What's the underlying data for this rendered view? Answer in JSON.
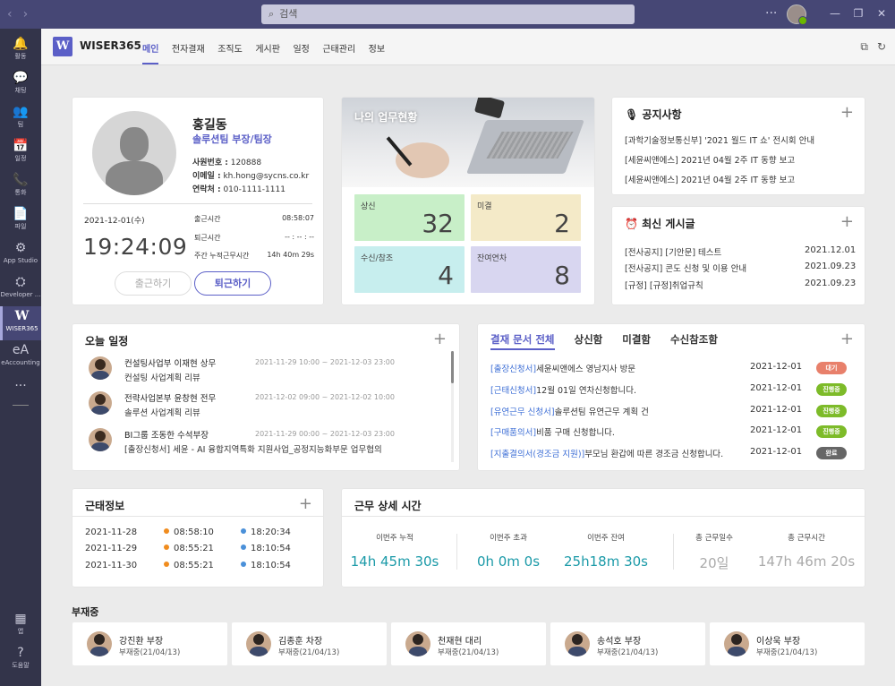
{
  "titlebar": {
    "search_placeholder": "검색"
  },
  "rail": [
    {
      "label": "활동",
      "icon": "bell-icon",
      "glyph": "🔔"
    },
    {
      "label": "채팅",
      "icon": "chat-icon",
      "glyph": "💬"
    },
    {
      "label": "팀",
      "icon": "team-icon",
      "glyph": "👥"
    },
    {
      "label": "일정",
      "icon": "calendar-icon",
      "glyph": "📅"
    },
    {
      "label": "통화",
      "icon": "phone-icon",
      "glyph": "📞"
    },
    {
      "label": "파일",
      "icon": "file-icon",
      "glyph": "📄"
    },
    {
      "label": "App Studio",
      "icon": "app-studio-icon",
      "glyph": "⚙"
    },
    {
      "label": "Developer ...",
      "icon": "developer-icon",
      "glyph": "⛭"
    },
    {
      "label": "WISER365",
      "icon": "wiser365-icon",
      "glyph": "W"
    },
    {
      "label": "eAccounting",
      "icon": "eaccounting-icon",
      "glyph": "eA"
    },
    {
      "label": "",
      "icon": "more-icon",
      "glyph": "···"
    }
  ],
  "rail_bottom": [
    {
      "label": "앱",
      "icon": "apps-icon",
      "glyph": "▦"
    },
    {
      "label": "도움말",
      "icon": "help-icon",
      "glyph": "?"
    }
  ],
  "appbar": {
    "logo_letter": "W",
    "app_name": "WISER365",
    "tabs": [
      "메인",
      "전자결재",
      "조직도",
      "게시판",
      "일정",
      "근태관리",
      "정보"
    ]
  },
  "profile": {
    "name": "홍길동",
    "title": "솔루션팀 부장/팀장",
    "emp_no_label": "사원번호 :",
    "emp_no": "120888",
    "email_label": "이메일 :",
    "email": "kh.hong@sycns.co.kr",
    "phone_label": "연락처 :",
    "phone": "010-1111-1111",
    "date": "2021-12-01(수)",
    "clock": "19:24:09",
    "checkin_label": "출근시간",
    "checkin": "08:58:07",
    "checkout_label": "퇴근시간",
    "checkout": "-- : -- : --",
    "weekly_label": "주간 누적근무시간",
    "weekly": "14h 40m 29s",
    "btn_checkin": "출근하기",
    "btn_checkout": "퇴근하기"
  },
  "work_status": {
    "title": "나의 업무현황",
    "tiles": [
      {
        "label": "상신",
        "value": "32"
      },
      {
        "label": "미결",
        "value": "2"
      },
      {
        "label": "수신/참조",
        "value": "4"
      },
      {
        "label": "잔여연차",
        "value": "8"
      }
    ]
  },
  "notice": {
    "title": "공지사항",
    "items": [
      "[과학기술정보통신부] '2021 월드 IT 쇼' 전시회 안내",
      "[세윤씨앤에스] 2021년 04월 2주 IT 동향 보고",
      "[세윤씨앤에스] 2021년 04월 2주 IT 동향 보고"
    ]
  },
  "recent_posts": {
    "title": "최신 게시글",
    "items": [
      {
        "text": "[전사공지] [기안문] 테스트",
        "date": "2021.12.01"
      },
      {
        "text": "[전사공지] 콘도 신청 및 이용 안내",
        "date": "2021.09.23"
      },
      {
        "text": "[규정] [규정]취업규칙",
        "date": "2021.09.23"
      }
    ]
  },
  "schedule": {
    "title": "오늘 일정",
    "items": [
      {
        "name": "컨설팅사업부 이재현 상무",
        "time": "2021-11-29 10:00 ~ 2021-12-03 23:00",
        "desc": "컨설팅 사업계획 리뷰"
      },
      {
        "name": "전략사업본부 윤창현 전무",
        "time": "2021-12-02 09:00 ~ 2021-12-02 10:00",
        "desc": "솔루션 사업계획 리뷰"
      },
      {
        "name": "BI그룹 조동한 수석부장",
        "time": "2021-11-29 00:00 ~ 2021-12-03 23:00",
        "desc": "[출장신청서] 세윤 - AI 융합지역특화 지원사업_공정지능화부문 업무협의"
      }
    ]
  },
  "approval": {
    "tabs": [
      "결재 문서 전체",
      "상신함",
      "미결함",
      "수신참조함"
    ],
    "items": [
      {
        "cat": "[출장신청서]",
        "text": "세윤씨앤에스 영남지사 방문",
        "date": "2021-12-01",
        "status": "대기",
        "color": "#e8806b"
      },
      {
        "cat": "[근태신청서]",
        "text": "12월 01일 연차신청합니다.",
        "date": "2021-12-01",
        "status": "진행중",
        "color": "#7dbb29"
      },
      {
        "cat": "[유연근무 신청서]",
        "text": "솔루션팀 유연근무 계획 건",
        "date": "2021-12-01",
        "status": "진행중",
        "color": "#7dbb29"
      },
      {
        "cat": "[구매품의서]",
        "text": "비품 구매 신청합니다.",
        "date": "2021-12-01",
        "status": "진행중",
        "color": "#7dbb29"
      },
      {
        "cat": "[지출결의서(경조금 지원)]",
        "text": "부모님 환갑에 따른 경조금 신청합니다.",
        "date": "2021-12-01",
        "status": "완료",
        "color": "#666666"
      }
    ]
  },
  "attendance": {
    "title": "근태정보",
    "rows": [
      {
        "date": "2021-11-28",
        "in": "08:58:10",
        "out": "18:20:34"
      },
      {
        "date": "2021-11-29",
        "in": "08:55:21",
        "out": "18:10:54"
      },
      {
        "date": "2021-11-30",
        "in": "08:55:21",
        "out": "18:10:54"
      }
    ]
  },
  "work_detail": {
    "title": "근무 상세 시간",
    "cols": [
      {
        "label": "이번주 누적",
        "value": "14h 45m 30s",
        "muted": false
      },
      {
        "label": "이번주 초과",
        "value": "0h 0m 0s",
        "muted": false
      },
      {
        "label": "이번주 잔여",
        "value": "25h18m 30s",
        "muted": false
      },
      {
        "label": "총 근무일수",
        "value": "20일",
        "muted": true
      },
      {
        "label": "총 근무시간",
        "value": "147h 46m 20s",
        "muted": true
      }
    ]
  },
  "absent": {
    "title": "부재중",
    "people": [
      {
        "name": "강진환 부장",
        "status": "부재중(21/04/13)"
      },
      {
        "name": "김종훈 차장",
        "status": "부재중(21/04/13)"
      },
      {
        "name": "천재현 대리",
        "status": "부재중(21/04/13)"
      },
      {
        "name": "송석호 부장",
        "status": "부재중(21/04/13)"
      },
      {
        "name": "이상욱 부장",
        "status": "부재중(21/04/13)"
      }
    ]
  },
  "colors": {
    "accent": "#5b5fc7",
    "rail": "#33344a",
    "titlebar": "#464775",
    "teal": "#1b9aa8"
  }
}
